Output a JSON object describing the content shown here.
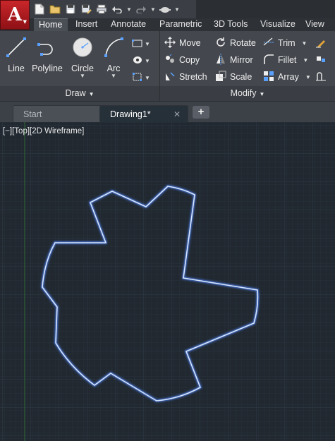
{
  "app": {
    "logo_letter": "A",
    "quick_access": [
      "new-icon",
      "open-icon",
      "save-icon",
      "save-as-icon",
      "plot-icon",
      "undo-icon",
      "redo-icon",
      "share-icon"
    ]
  },
  "ribbon": {
    "tabs": [
      {
        "label": "Home",
        "active": true
      },
      {
        "label": "Insert"
      },
      {
        "label": "Annotate"
      },
      {
        "label": "Parametric"
      },
      {
        "label": "3D Tools"
      },
      {
        "label": "Visualize"
      },
      {
        "label": "View"
      }
    ],
    "draw": {
      "title": "Draw",
      "line": "Line",
      "polyline": "Polyline",
      "circle": "Circle",
      "arc": "Arc"
    },
    "modify": {
      "title": "Modify",
      "move": "Move",
      "rotate": "Rotate",
      "trim": "Trim",
      "copy": "Copy",
      "mirror": "Mirror",
      "fillet": "Fillet",
      "stretch": "Stretch",
      "scale": "Scale",
      "array": "Array"
    }
  },
  "file_tabs": [
    {
      "label": "Start",
      "active": false
    },
    {
      "label": "Drawing1*",
      "active": true,
      "close": "✕"
    }
  ],
  "new_tab_symbol": "+",
  "viewport": {
    "controls": "[−][Top][2D Wireframe]",
    "background": "#212830",
    "shape_stroke": "#d6e6ff",
    "shape_glow": "#4f86ff"
  },
  "colors": {
    "brand_red": "#c9262a",
    "ribbon_bg": "#44484e",
    "accent": "#4f86ff"
  }
}
